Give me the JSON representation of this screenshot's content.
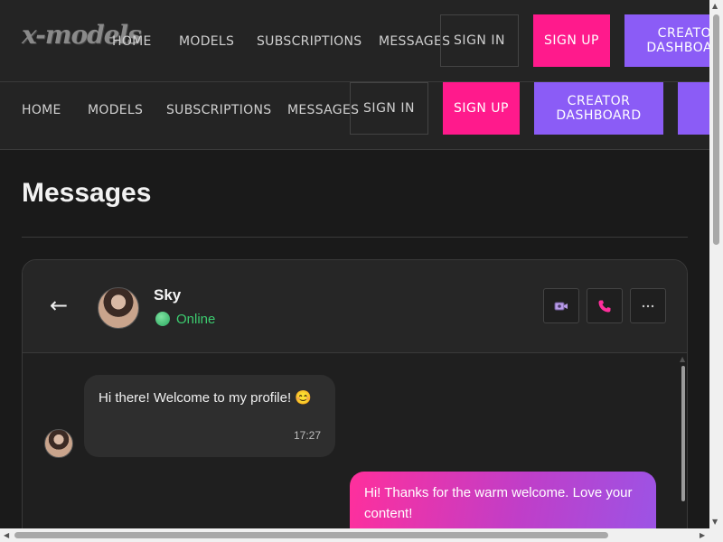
{
  "header": {
    "logo": "x-models",
    "nav": [
      "HOME",
      "MODELS",
      "SUBSCRIPTIONS",
      "MESSAGES"
    ],
    "sign_in": "SIGN IN",
    "sign_up": "SIGN UP",
    "creator_dashboard": "CREATOR DASHBOARD"
  },
  "page": {
    "title": "Messages"
  },
  "chat": {
    "back_icon": "←",
    "contact_name": "Sky",
    "status": "Online",
    "actions": [
      "video-icon",
      "phone-icon",
      "more-icon"
    ],
    "messages": [
      {
        "direction": "in",
        "text": "Hi there! Welcome to my profile! 😊",
        "time": "17:27"
      },
      {
        "direction": "out",
        "text": "Hi! Thanks for the warm welcome. Love your content!"
      }
    ]
  },
  "colors": {
    "accent_pink": "#ff1a8c",
    "accent_purple": "#8b5cf6",
    "online_green": "#3ccb6f"
  }
}
